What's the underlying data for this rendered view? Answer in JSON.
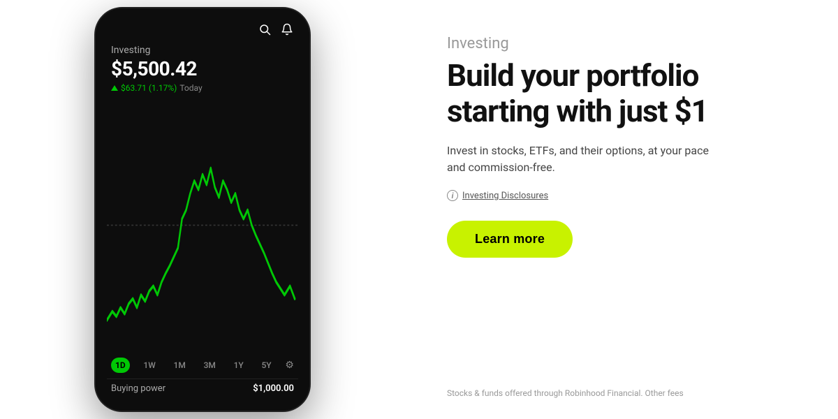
{
  "left": {
    "phone": {
      "portfolio_label": "Investing",
      "portfolio_value": "$5,500.42",
      "change_amount": "$63.71 (1.17%)",
      "change_period": "Today",
      "time_buttons": [
        "1D",
        "1W",
        "1M",
        "3M",
        "1Y",
        "5Y"
      ],
      "active_time": "1D",
      "buying_power_label": "Buying power",
      "buying_power_value": "$1,000.00"
    }
  },
  "right": {
    "section_label": "Investing",
    "heading_line1": "Build your portfolio",
    "heading_line2": "starting with just $1",
    "sub_text": "Invest in stocks, ETFs, and their options, at your pace and commission-free.",
    "disclosures_text": "Investing Disclosures",
    "learn_more_label": "Learn more",
    "footer_text": "Stocks & funds offered through Robinhood Financial. Other fees"
  },
  "icons": {
    "search": "search-icon",
    "bell": "bell-icon",
    "info": "info-icon",
    "gear": "gear-icon"
  },
  "colors": {
    "green": "#00c805",
    "accent": "#c8f200",
    "phone_bg": "#0d0d0d",
    "white": "#ffffff"
  }
}
